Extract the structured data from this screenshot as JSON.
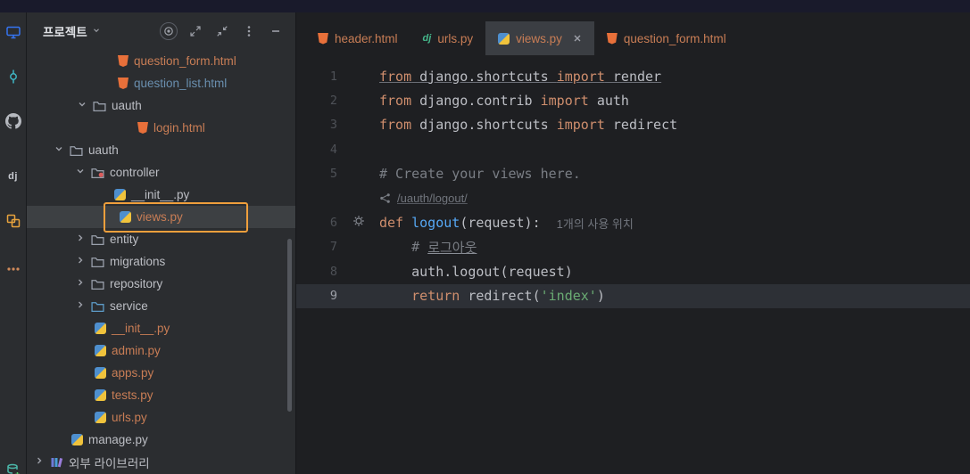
{
  "colors": {
    "editor_bg": "#1e1f22",
    "panel_bg": "#2b2d30",
    "selection_bg": "#3d4043",
    "highlight_border": "#ef9f3c",
    "keyword": "#cf8e6d",
    "string": "#6aab73",
    "comment": "#7a7e85",
    "function_name": "#56a8f5",
    "untracked_file": "#c87d55",
    "modified_file": "#6a8faf"
  },
  "activity_bar": {
    "icons": [
      "monitor-icon",
      "commit-icon",
      "github-icon",
      "django-tool-icon",
      "structure-icon",
      "more-tools-icon",
      "database-add-icon"
    ]
  },
  "icons": {
    "django_glyph": "dj"
  },
  "project_panel": {
    "title": "프로젝트",
    "header_icons": [
      "locate-target-icon",
      "expand-icon",
      "collapse-icon",
      "kebab-menu-icon",
      "hide-panel-icon"
    ],
    "items": [
      {
        "label": "question_form.html"
      },
      {
        "label": "question_list.html"
      },
      {
        "label": "uauth"
      },
      {
        "label": "login.html"
      },
      {
        "label": "uauth"
      },
      {
        "label": "controller"
      },
      {
        "label": "__init__.py"
      },
      {
        "label": "views.py"
      },
      {
        "label": "entity"
      },
      {
        "label": "migrations"
      },
      {
        "label": "repository"
      },
      {
        "label": "service"
      },
      {
        "label": "__init__.py"
      },
      {
        "label": "admin.py"
      },
      {
        "label": "apps.py"
      },
      {
        "label": "tests.py"
      },
      {
        "label": "urls.py"
      },
      {
        "label": "manage.py"
      },
      {
        "label": "외부 라이브러리"
      }
    ]
  },
  "tabs": [
    {
      "label": "header.html",
      "icon": "html-file-icon",
      "active": false
    },
    {
      "label": "urls.py",
      "icon": "django-file-icon",
      "active": false
    },
    {
      "label": "views.py",
      "icon": "python-file-icon",
      "active": true,
      "closable": true
    },
    {
      "label": "question_form.html",
      "icon": "html-file-icon",
      "active": false
    }
  ],
  "editor": {
    "url_inlay": "/uauth/logout/",
    "lines": [
      {
        "num": "1",
        "segments": [
          "from",
          " django.shortcuts ",
          "import",
          " render"
        ]
      },
      {
        "num": "2",
        "segments": [
          "from",
          " django.contrib ",
          "import",
          " auth"
        ]
      },
      {
        "num": "3",
        "segments": [
          "from",
          " django.shortcuts ",
          "import",
          " redirect"
        ]
      },
      {
        "num": "4",
        "segments": []
      },
      {
        "num": "5",
        "segments": [
          "# Create your views here."
        ]
      },
      {
        "num": "6",
        "segments": [
          "def",
          " ",
          "logout",
          "(request):"
        ],
        "hint": "1개의 사용 위치"
      },
      {
        "num": "7",
        "segments": [
          "    # ",
          "로그아웃"
        ]
      },
      {
        "num": "8",
        "segments": [
          "    auth.logout(request)"
        ]
      },
      {
        "num": "9",
        "segments": [
          "    ",
          "return",
          " redirect(",
          "'index'",
          ")"
        ]
      }
    ]
  }
}
